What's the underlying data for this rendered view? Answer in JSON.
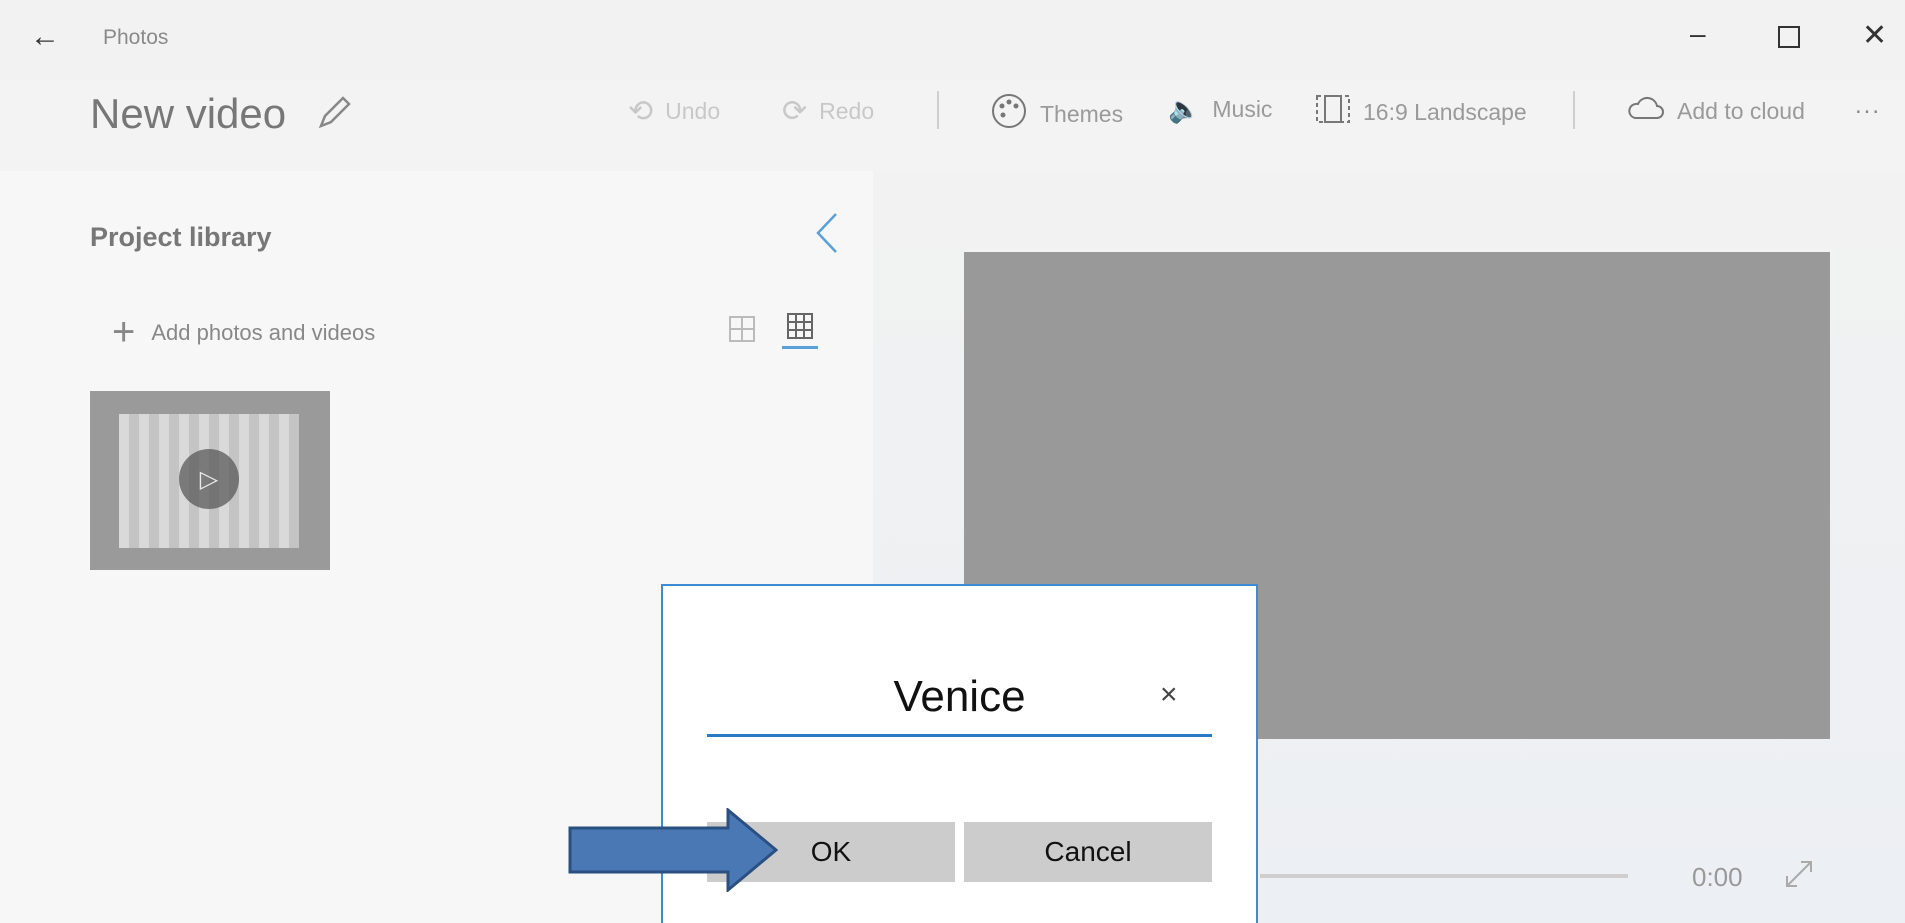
{
  "app": {
    "window_title": "Photos",
    "project_title": "New video"
  },
  "toolbar": {
    "undo_label": "Undo",
    "redo_label": "Redo",
    "themes_label": "Themes",
    "music_label": "Music",
    "aspect_label": "16:9 Landscape",
    "cloud_label": "Add to cloud",
    "more_label": "..."
  },
  "library": {
    "heading": "Project library",
    "add_label": "Add photos and videos"
  },
  "player": {
    "time": "0:00"
  },
  "dialog": {
    "name_value": "Venice",
    "ok_label": "OK",
    "cancel_label": "Cancel"
  },
  "colors": {
    "accent": "#2b78c5",
    "arrow_fill": "#4a78b5",
    "arrow_stroke": "#2a4f80"
  }
}
